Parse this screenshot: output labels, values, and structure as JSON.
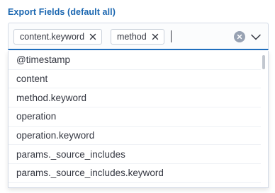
{
  "label": "Export Fields (default all)",
  "selected": [
    {
      "label": "content.keyword"
    },
    {
      "label": "method"
    }
  ],
  "options": [
    "@timestamp",
    "content",
    "method.keyword",
    "operation",
    "operation.keyword",
    "params._source_includes",
    "params._source_includes.keyword"
  ],
  "icons": {
    "pill_remove": "close-icon",
    "clear": "clear-circle-icon",
    "toggle": "chevron-down-icon"
  },
  "colors": {
    "label": "#1a66b0",
    "focus_border": "#1f6fbf",
    "text": "#343741",
    "clear_bg": "#98a2b3"
  }
}
